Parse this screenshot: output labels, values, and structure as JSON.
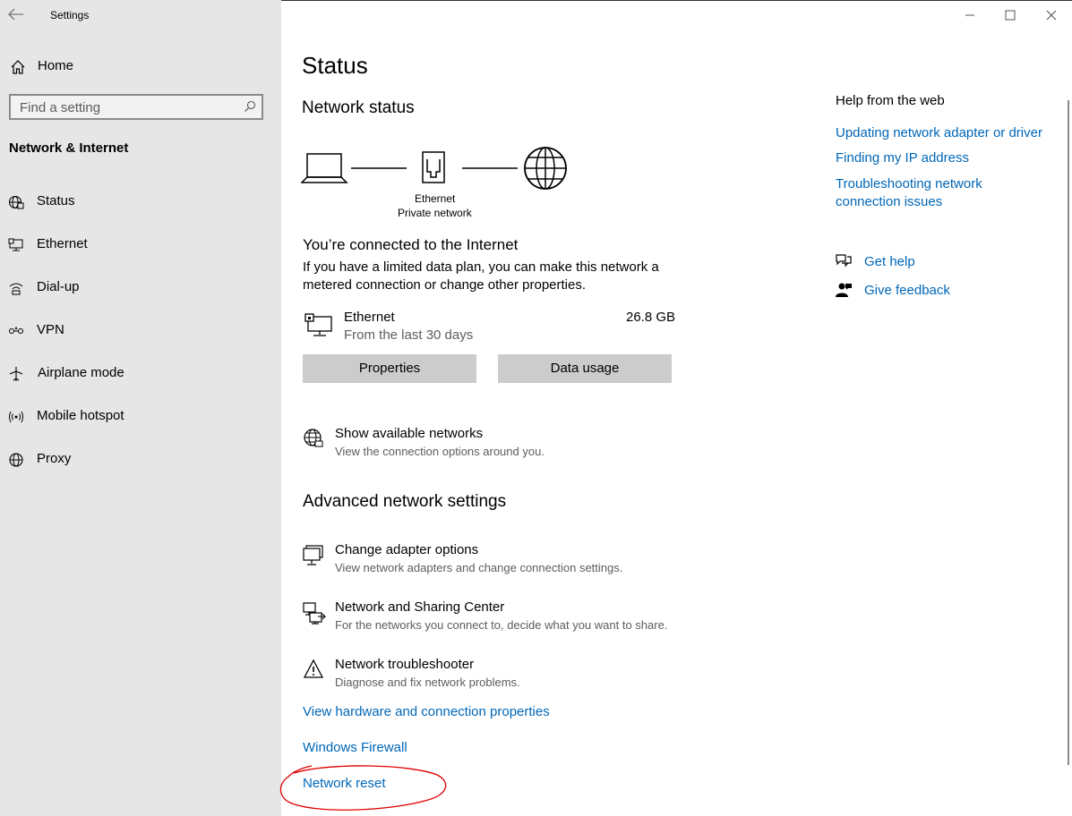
{
  "window": {
    "title": "Settings"
  },
  "sidebar": {
    "home_label": "Home",
    "search_placeholder": "Find a setting",
    "section_title": "Network & Internet",
    "items": [
      {
        "label": "Status",
        "icon": "globe-status-icon"
      },
      {
        "label": "Ethernet",
        "icon": "ethernet-icon"
      },
      {
        "label": "Dial-up",
        "icon": "dialup-icon"
      },
      {
        "label": "VPN",
        "icon": "vpn-icon"
      },
      {
        "label": "Airplane mode",
        "icon": "airplane-icon"
      },
      {
        "label": "Mobile hotspot",
        "icon": "hotspot-icon"
      },
      {
        "label": "Proxy",
        "icon": "globe-icon"
      }
    ]
  },
  "main": {
    "title": "Status",
    "network_status_heading": "Network status",
    "diagram": {
      "adapter_name": "Ethernet",
      "network_type": "Private network"
    },
    "connected_heading": "You’re connected to the Internet",
    "connected_desc_line1": "If you have a limited data plan, you can make this network a",
    "connected_desc_line2": "metered connection or change other properties.",
    "usage": {
      "name": "Ethernet",
      "period": "From the last 30 days",
      "amount": "26.8 GB"
    },
    "buttons": {
      "properties": "Properties",
      "data_usage": "Data usage"
    },
    "show_networks": {
      "title": "Show available networks",
      "desc": "View the connection options around you."
    },
    "advanced_heading": "Advanced network settings",
    "advanced_items": [
      {
        "title": "Change adapter options",
        "desc": "View network adapters and change connection settings."
      },
      {
        "title": "Network and Sharing Center",
        "desc": "For the networks you connect to, decide what you want to share."
      },
      {
        "title": "Network troubleshooter",
        "desc": "Diagnose and fix network problems."
      }
    ],
    "links": {
      "hardware": "View hardware and connection properties",
      "firewall": "Windows Firewall",
      "reset": "Network reset"
    }
  },
  "help": {
    "heading": "Help from the web",
    "links": [
      "Updating network adapter or driver",
      "Finding my IP address",
      "Troubleshooting network",
      "connection issues"
    ],
    "get_help": "Get help",
    "give_feedback": "Give feedback"
  },
  "colors": {
    "accent": "#0067b8",
    "sidebar_bg": "#e6e6e6",
    "annotation": "#e00000"
  }
}
